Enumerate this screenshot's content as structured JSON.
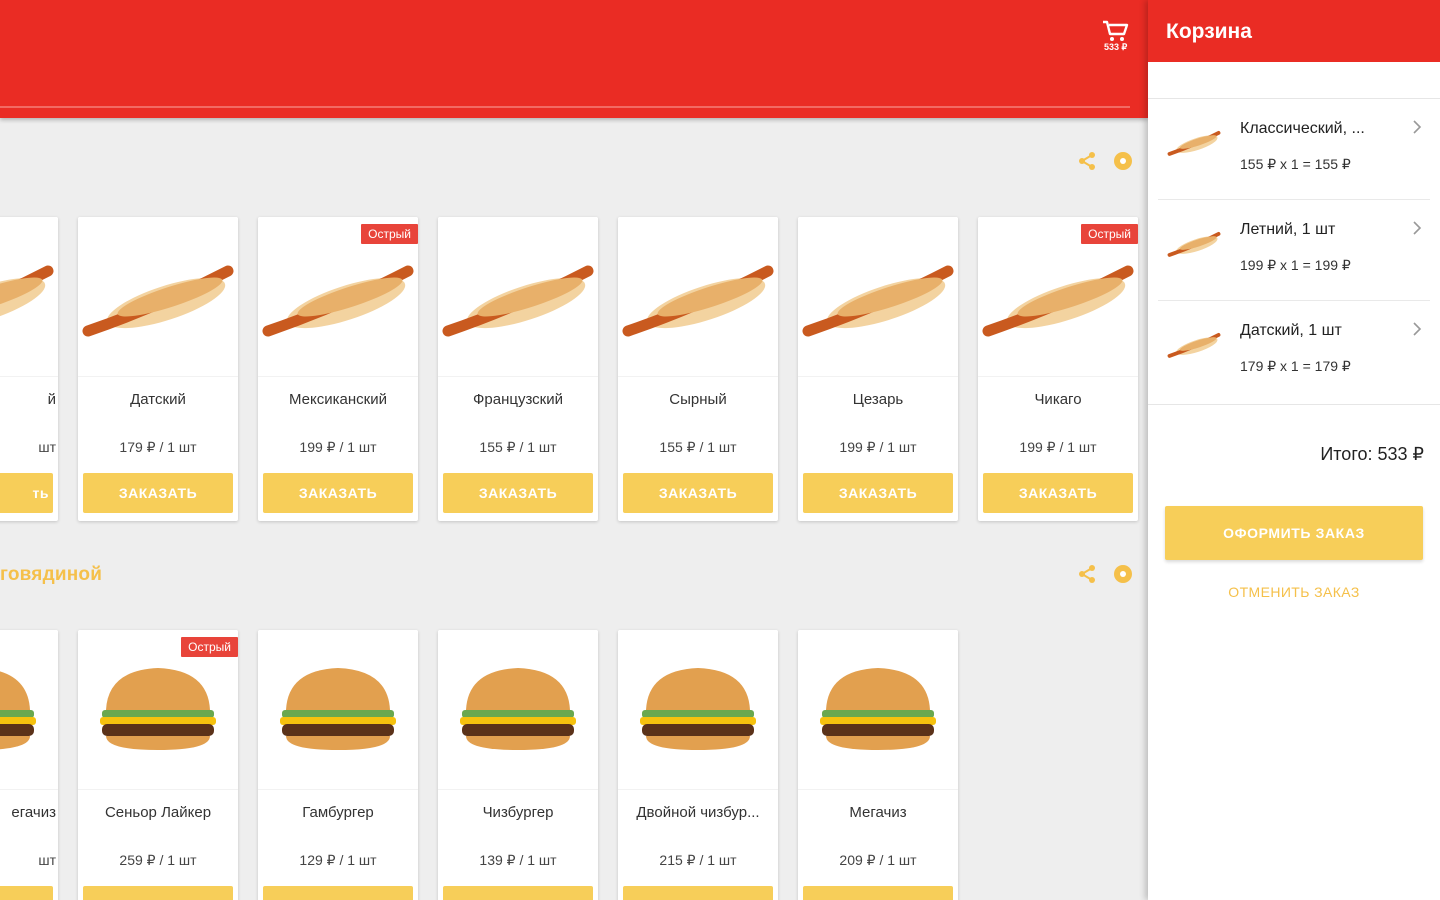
{
  "colors": {
    "primary": "#ea2c24",
    "accent": "#f7ce59",
    "badge": "#e8443a"
  },
  "header": {
    "cart_amount": "533 ₽"
  },
  "sections": [
    {
      "title": "",
      "icons": [
        "share-icon",
        "info-icon"
      ]
    },
    {
      "title": "говядиной",
      "icons": [
        "share-icon",
        "info-icon"
      ]
    }
  ],
  "row1": [
    {
      "name": "й",
      "price": "шт",
      "button": "ть",
      "badge": ""
    },
    {
      "name": "Датский",
      "price": "179 ₽ / 1 шт",
      "button": "ЗАКАЗАТЬ",
      "badge": ""
    },
    {
      "name": "Мексиканский",
      "price": "199 ₽ / 1 шт",
      "button": "ЗАКАЗАТЬ",
      "badge": "Острый"
    },
    {
      "name": "Французский",
      "price": "155 ₽ / 1 шт",
      "button": "ЗАКАЗАТЬ",
      "badge": ""
    },
    {
      "name": "Сырный",
      "price": "155 ₽ / 1 шт",
      "button": "ЗАКАЗАТЬ",
      "badge": ""
    },
    {
      "name": "Цезарь",
      "price": "199 ₽ / 1 шт",
      "button": "ЗАКАЗАТЬ",
      "badge": ""
    },
    {
      "name": "Чикаго",
      "price": "199 ₽ / 1 шт",
      "button": "ЗАКАЗАТЬ",
      "badge": "Острый"
    }
  ],
  "row2": [
    {
      "name": "егачиз",
      "price": "шт",
      "badge": ""
    },
    {
      "name": "Сеньор Лайкер",
      "price": "259 ₽ / 1 шт",
      "badge": "Острый"
    },
    {
      "name": "Гамбургер",
      "price": "129 ₽ / 1 шт",
      "badge": ""
    },
    {
      "name": "Чизбургер",
      "price": "139 ₽ / 1 шт",
      "badge": ""
    },
    {
      "name": "Двойной чизбур...",
      "price": "215 ₽ / 1 шт",
      "badge": ""
    },
    {
      "name": "Мегачиз",
      "price": "209 ₽ / 1 шт",
      "badge": ""
    }
  ],
  "cart": {
    "title": "Корзина",
    "items": [
      {
        "name": "Классический, ...",
        "calc": "155 ₽ x 1 = 155 ₽"
      },
      {
        "name": "Летний, 1 шт",
        "calc": "199 ₽ x 1 = 199 ₽"
      },
      {
        "name": "Датский, 1 шт",
        "calc": "179 ₽ x 1 = 179 ₽"
      }
    ],
    "total": "Итого: 533 ₽",
    "checkout": "ОФОРМИТЬ ЗАКАЗ",
    "cancel": "ОТМЕНИТЬ ЗАКАЗ"
  }
}
